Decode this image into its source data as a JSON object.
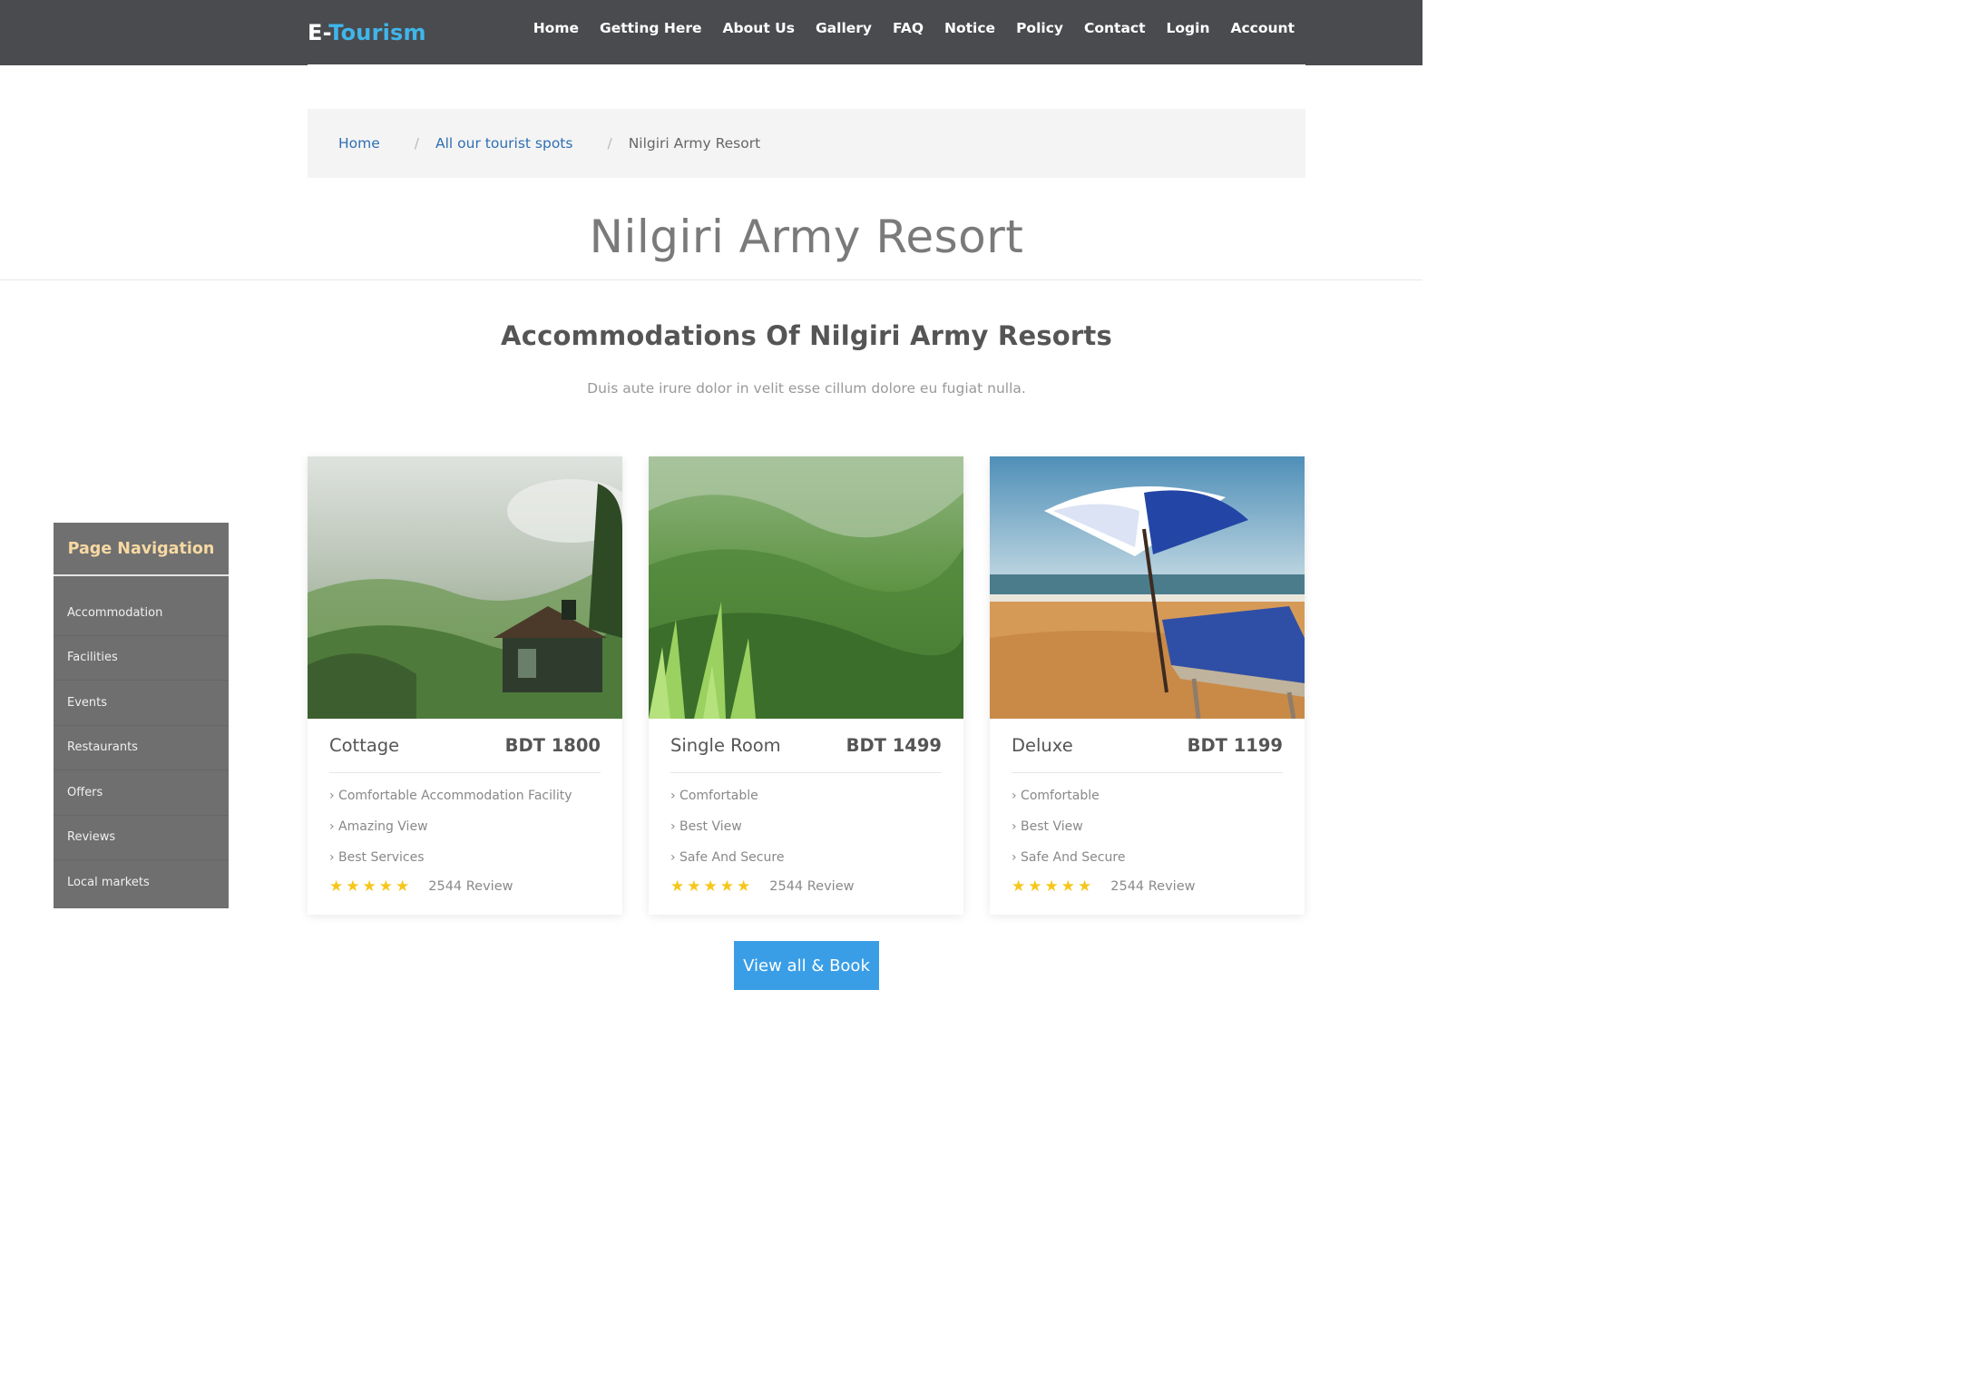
{
  "header": {
    "logo_prefix": "E-",
    "logo_main": "Tourism",
    "nav": [
      "Home",
      "Getting Here",
      "About Us",
      "Gallery",
      "FAQ",
      "Notice",
      "Policy",
      "Contact",
      "Login",
      "Account"
    ]
  },
  "breadcrumb": {
    "home": "Home",
    "spots": "All our tourist spots",
    "current": "Nilgiri Army Resort",
    "separator": "/"
  },
  "page": {
    "title": "Nilgiri Army Resort",
    "section_title": "Accommodations Of Nilgiri Army Resorts",
    "section_subtitle": "Duis aute irure dolor in velit esse cillum dolore eu fugiat nulla."
  },
  "sidenav": {
    "heading": "Page Navigation",
    "items": [
      "Accommodation",
      "Facilities",
      "Events",
      "Restaurants",
      "Offers",
      "Reviews",
      "Local markets"
    ]
  },
  "cards": [
    {
      "name": "Cottage",
      "price": "BDT 1800",
      "features": [
        "› Comfortable Accommodation Facility",
        "› Amazing View",
        "› Best Services"
      ],
      "rating_stars": 5,
      "reviews": "2544 Review"
    },
    {
      "name": "Single Room",
      "price": "BDT 1499",
      "features": [
        "› Comfortable",
        "› Best View",
        "› Safe And Secure"
      ],
      "rating_stars": 5,
      "reviews": "2544 Review"
    },
    {
      "name": "Deluxe",
      "price": "BDT 1199",
      "features": [
        "› Comfortable",
        "› Best View",
        "› Safe And Secure"
      ],
      "rating_stars": 5,
      "reviews": "2544 Review"
    }
  ],
  "cta": {
    "label": "View all & Book"
  },
  "colors": {
    "header_bg": "#4a4b4f",
    "brand_accent": "#3fb6ea",
    "link": "#2f6fb3",
    "star": "#f7c61a",
    "button": "#3a9ee6",
    "sidenav_bg": "#6f6f6f",
    "sidenav_heading": "#f7d9a2"
  }
}
